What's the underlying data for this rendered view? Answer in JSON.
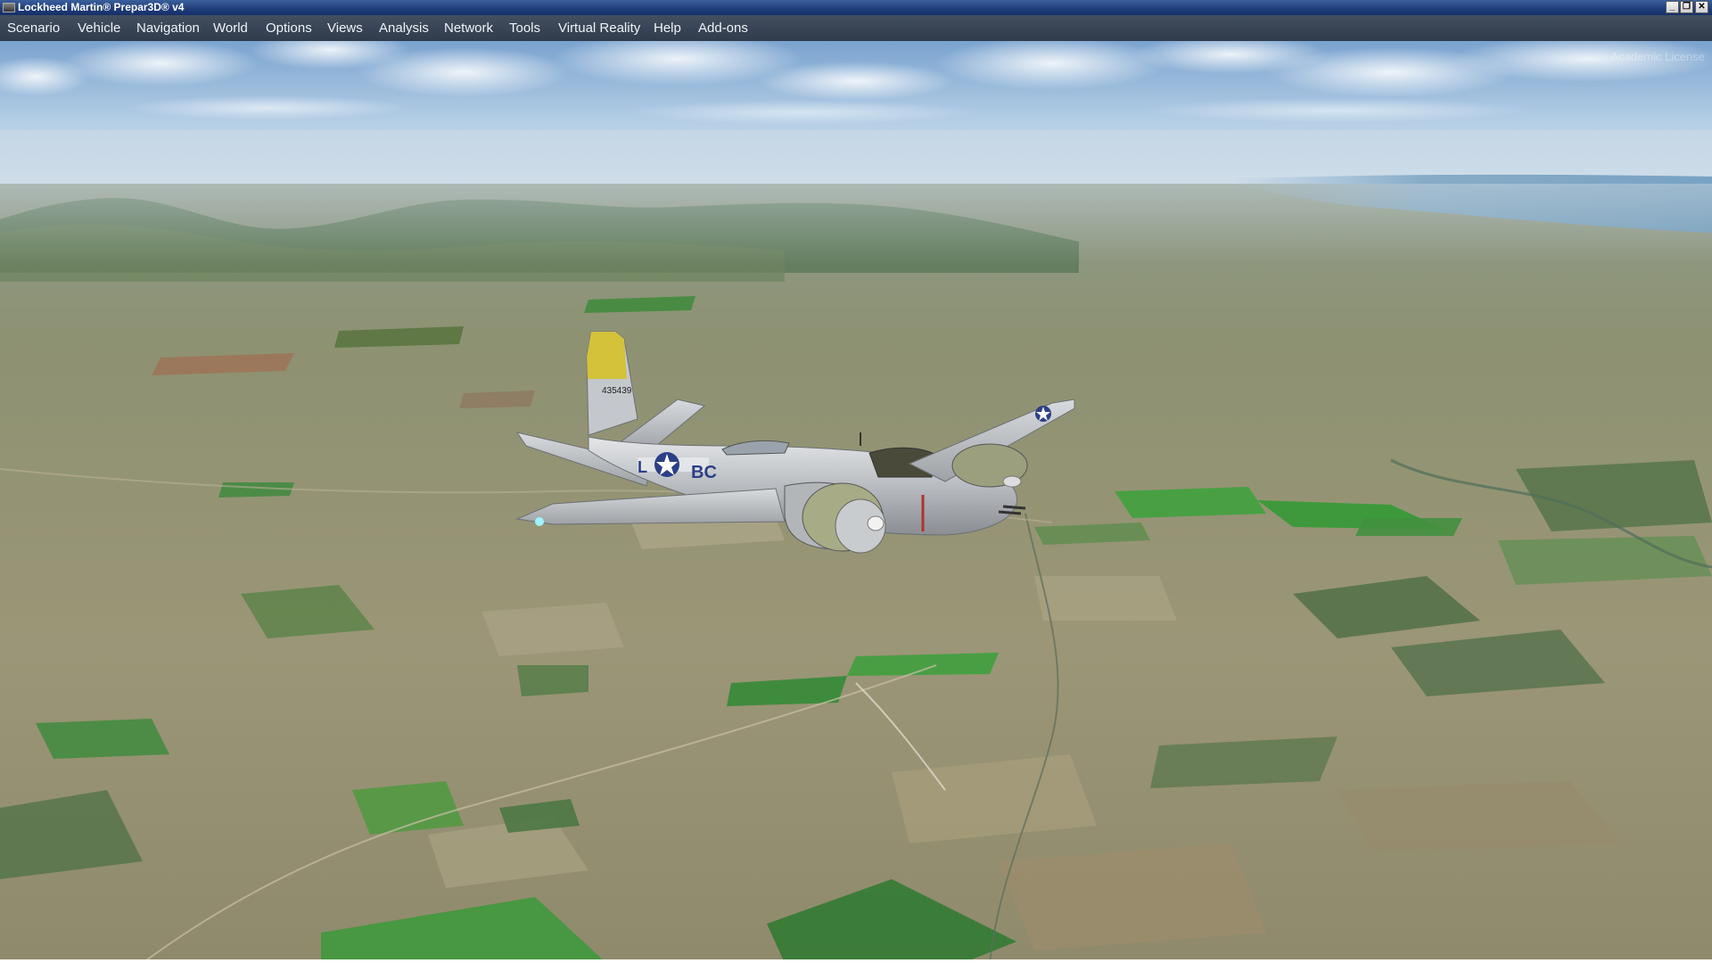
{
  "window": {
    "title": "Lockheed Martin® Prepar3D® v4",
    "controls": {
      "minimize": "_",
      "maximize": "❐",
      "close": "✕"
    }
  },
  "menu": [
    {
      "label": "Scenario"
    },
    {
      "label": "Vehicle"
    },
    {
      "label": "Navigation"
    },
    {
      "label": "World"
    },
    {
      "label": "Options"
    },
    {
      "label": "Views"
    },
    {
      "label": "Analysis"
    },
    {
      "label": "Network"
    },
    {
      "label": "Tools"
    },
    {
      "label": "Virtual Reality"
    },
    {
      "label": "Help"
    },
    {
      "label": "Add-ons"
    }
  ],
  "scene": {
    "watermark": "Academic License",
    "aircraft": {
      "serial": "435439",
      "code_left": "L",
      "code_right": "BC"
    }
  },
  "colors": {
    "titlebar": "#1f3c78",
    "menubar": "#3e4b5e",
    "sky_top": "#6e9bc8",
    "terrain": "#9a9a7c",
    "tail_band": "#d6c43a"
  }
}
